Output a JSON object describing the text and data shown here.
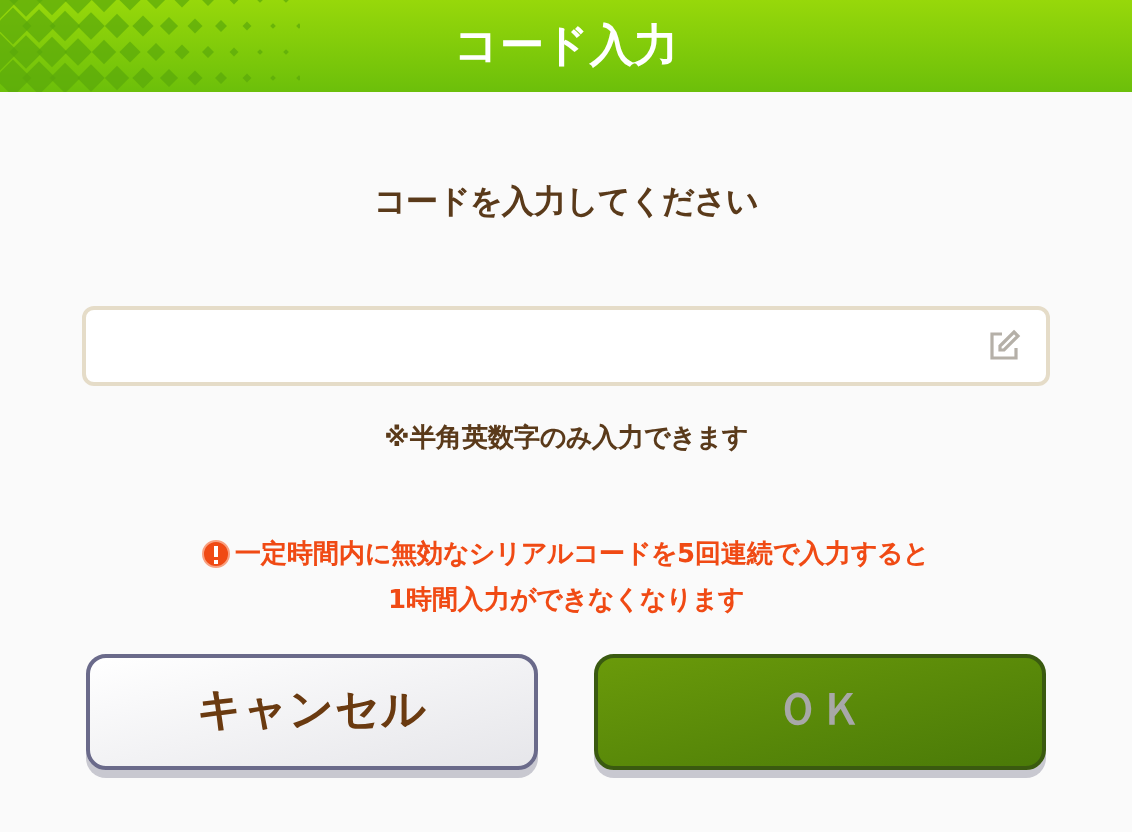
{
  "dialog": {
    "title": "コード入力",
    "prompt": "コードを入力してください",
    "note": "※半角英数字のみ入力できます",
    "warning": [
      "一定時間内に無効なシリアルコードを5回連続で入力すると",
      "1時間入力ができなくなります"
    ],
    "buttons": [
      {
        "label": "キャンセル",
        "kind": "secondary",
        "disabled": false
      },
      {
        "label": "ＯＫ",
        "kind": "primary",
        "disabled": true
      }
    ]
  }
}
